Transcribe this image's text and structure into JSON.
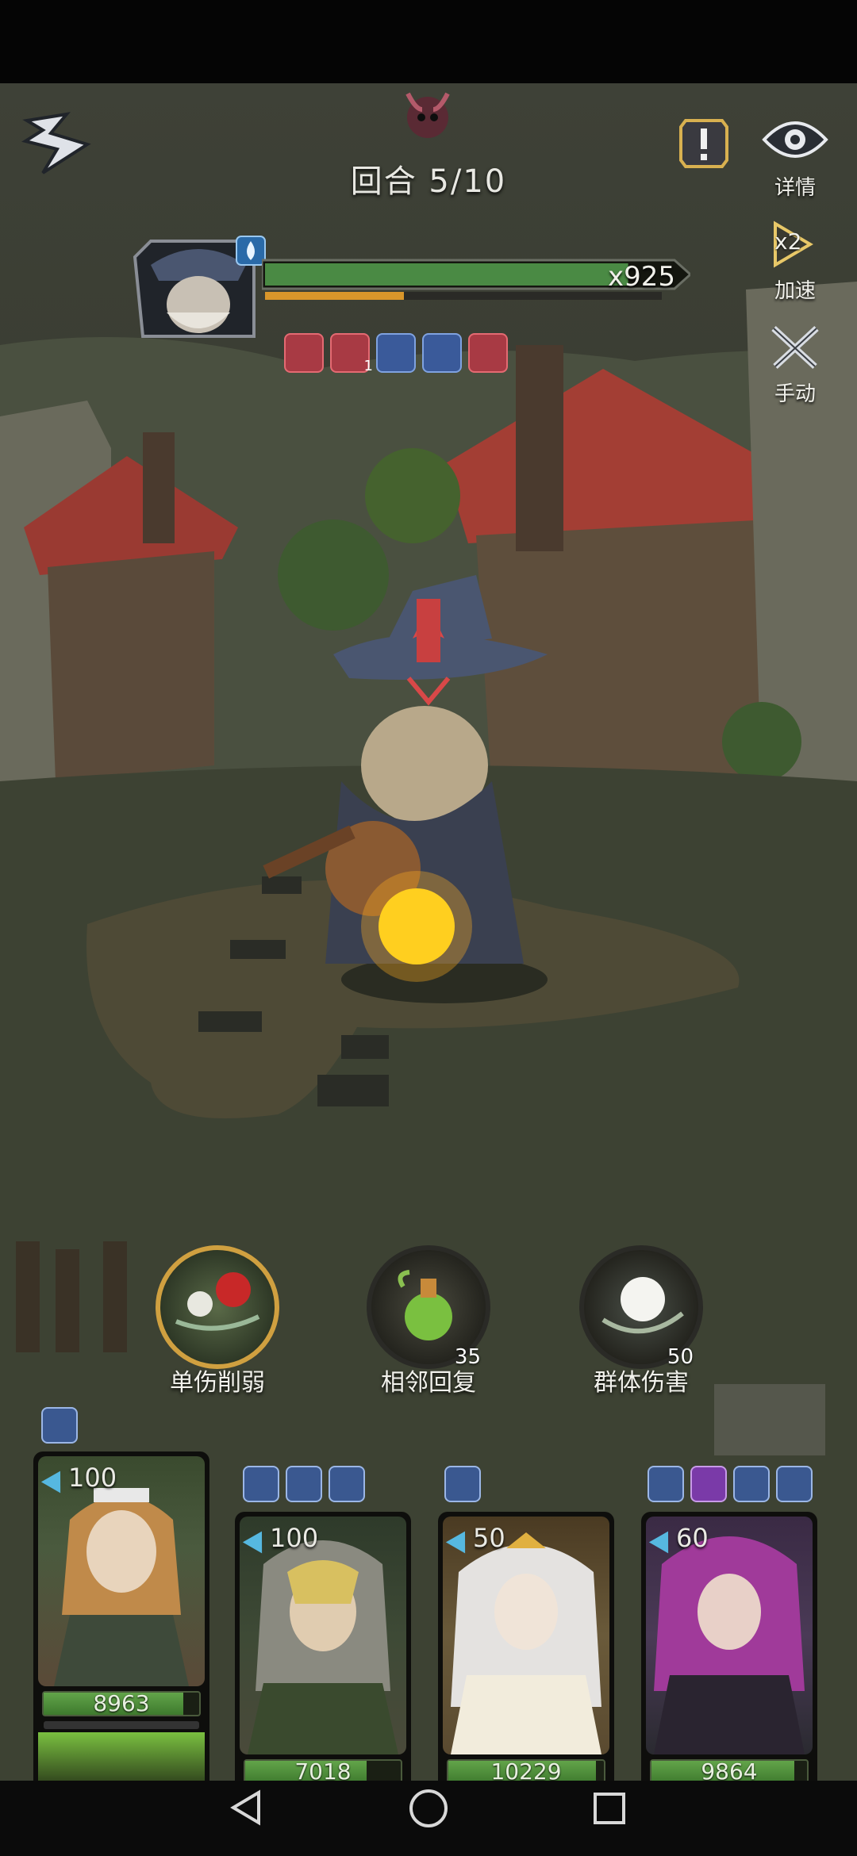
{
  "hud": {
    "round_text": "回合 5/10",
    "details_label": "详情",
    "speed_label": "加速",
    "speed_badge": "x2",
    "manual_label": "手动"
  },
  "boss": {
    "multiplier": "x925",
    "hp_fraction": 0.88,
    "charge_fraction": 0.35,
    "buffs": [
      {
        "icon": "fire-down-icon",
        "color": "red",
        "count": ""
      },
      {
        "icon": "sword-down-icon",
        "color": "red",
        "count": "1"
      },
      {
        "icon": "sword-up-icon",
        "color": "blue",
        "count": ""
      },
      {
        "icon": "sword-up-icon",
        "color": "blue",
        "count": ""
      },
      {
        "icon": "sword-down-icon",
        "color": "red",
        "count": ""
      }
    ]
  },
  "skills": [
    {
      "label": "单伤削弱",
      "cost": "",
      "icon": "rose-icon"
    },
    {
      "label": "相邻回复",
      "cost": "35",
      "icon": "potion-icon"
    },
    {
      "label": "群体伤害",
      "cost": "50",
      "icon": "moon-icon"
    }
  ],
  "heroes": [
    {
      "name": "maid",
      "energy": "100",
      "hp": "8963",
      "hp_fraction": 0.9,
      "sub_fraction": 0.0
    },
    {
      "name": "hooded-archer",
      "energy": "100",
      "hp": "7018",
      "hp_fraction": 0.78,
      "sub_fraction": 0.4
    },
    {
      "name": "white-queen",
      "energy": "50",
      "hp": "10229",
      "hp_fraction": 0.95,
      "sub_fraction": 0.0
    },
    {
      "name": "purple-witch",
      "energy": "60",
      "hp": "9864",
      "hp_fraction": 0.92,
      "sub_fraction": 0.0
    }
  ],
  "colors": {
    "hp_green": "#5a9a44",
    "boss_red": "#c0404a",
    "energy_blue": "#56b8e0"
  }
}
